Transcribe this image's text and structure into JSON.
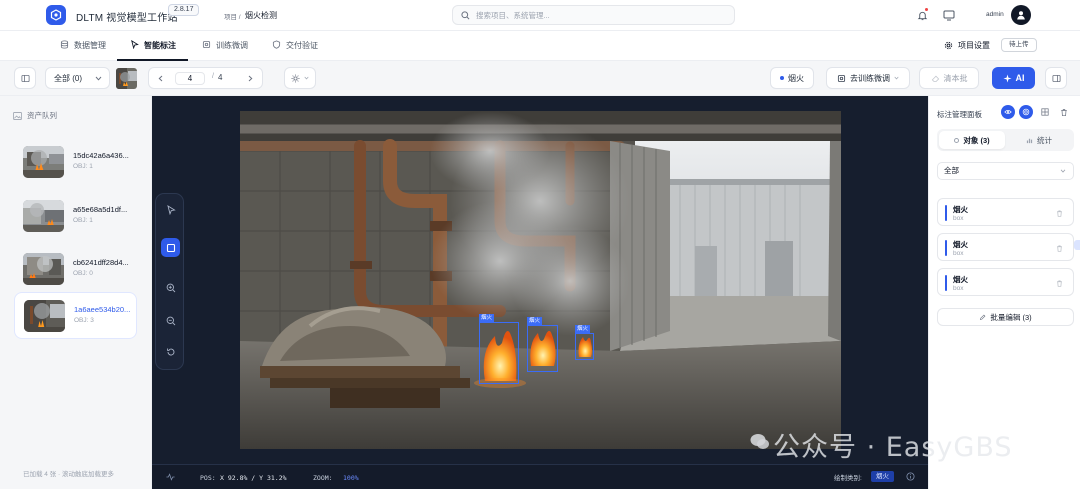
{
  "header": {
    "app_title": "DLTM 视觉模型工作站",
    "version": "2.8.17",
    "crumb_label": "项目 /",
    "project_name": "烟火检测",
    "search_placeholder": "搜索项目、系统管理...",
    "user_name": "admin"
  },
  "tabs": [
    {
      "label": "数据管理",
      "icon": "database-icon",
      "active": false
    },
    {
      "label": "智能标注",
      "icon": "cursor-icon",
      "active": true
    },
    {
      "label": "训练微调",
      "icon": "train-icon",
      "active": false
    },
    {
      "label": "交付验证",
      "icon": "shield-check-icon",
      "active": false
    }
  ],
  "project_settings": "项目设置",
  "upload_badge": "待上传",
  "toolbar": {
    "filter_value": "全部 (0)",
    "current_page": "4",
    "total_pages": "4",
    "class_chip": "烟火",
    "to_training": "去训练微调",
    "clear_batch": "清本批",
    "ai_label": "AI"
  },
  "left_panel": {
    "title": "资产队列",
    "assets": [
      {
        "name": "15dc42a6a436...",
        "obj": "OBJ: 1",
        "active": false
      },
      {
        "name": "a65e68a5d1df...",
        "obj": "OBJ: 1",
        "active": false
      },
      {
        "name": "cb6241dff28d4...",
        "obj": "OBJ: 0",
        "active": false
      },
      {
        "name": "1a6aee534b20...",
        "obj": "OBJ: 3",
        "active": true
      }
    ],
    "footer": "已加载 4 张 · 滚动触底加载更多"
  },
  "canvas": {
    "boxes": [
      {
        "label": "烟火"
      },
      {
        "label": "烟火"
      },
      {
        "label": "烟火"
      }
    ],
    "pos_label": "POS:",
    "pos_value": "X 92.8% / Y 31.2%",
    "zoom_label": "ZOOM:",
    "zoom_value": "100%",
    "draw_label": "绘制类别:",
    "draw_class": "烟火"
  },
  "right_panel": {
    "title": "标注管理面板",
    "seg_objects": "对象 (3)",
    "seg_stats": "统计",
    "filter": "全部",
    "objects": [
      {
        "name": "烟火",
        "type": "box"
      },
      {
        "name": "烟火",
        "type": "box"
      },
      {
        "name": "烟火",
        "type": "box"
      }
    ],
    "batch_edit": "批量编辑 (3)"
  },
  "watermark": "公众号 · EasyGBS",
  "colors": {
    "accent": "#2f5bea",
    "canvas_bg": "#161e2e",
    "box": "#3b6cf6"
  }
}
